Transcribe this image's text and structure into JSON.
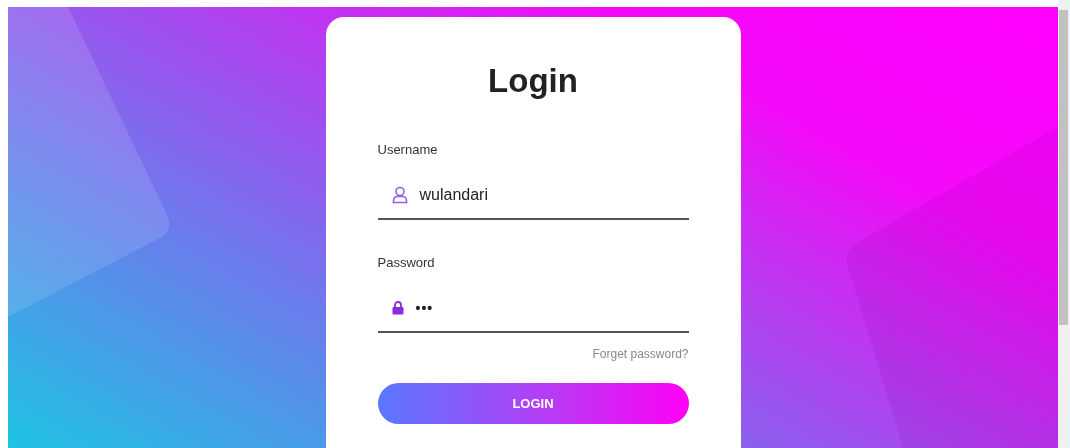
{
  "login_card": {
    "title": "Login",
    "fields": [
      {
        "kind": "text",
        "label": "Username",
        "value": "wulandari"
      },
      {
        "kind": "password",
        "label": "Password",
        "value": "•••"
      }
    ],
    "forgot_link": "Forget password?",
    "button": "LOGIN"
  }
}
